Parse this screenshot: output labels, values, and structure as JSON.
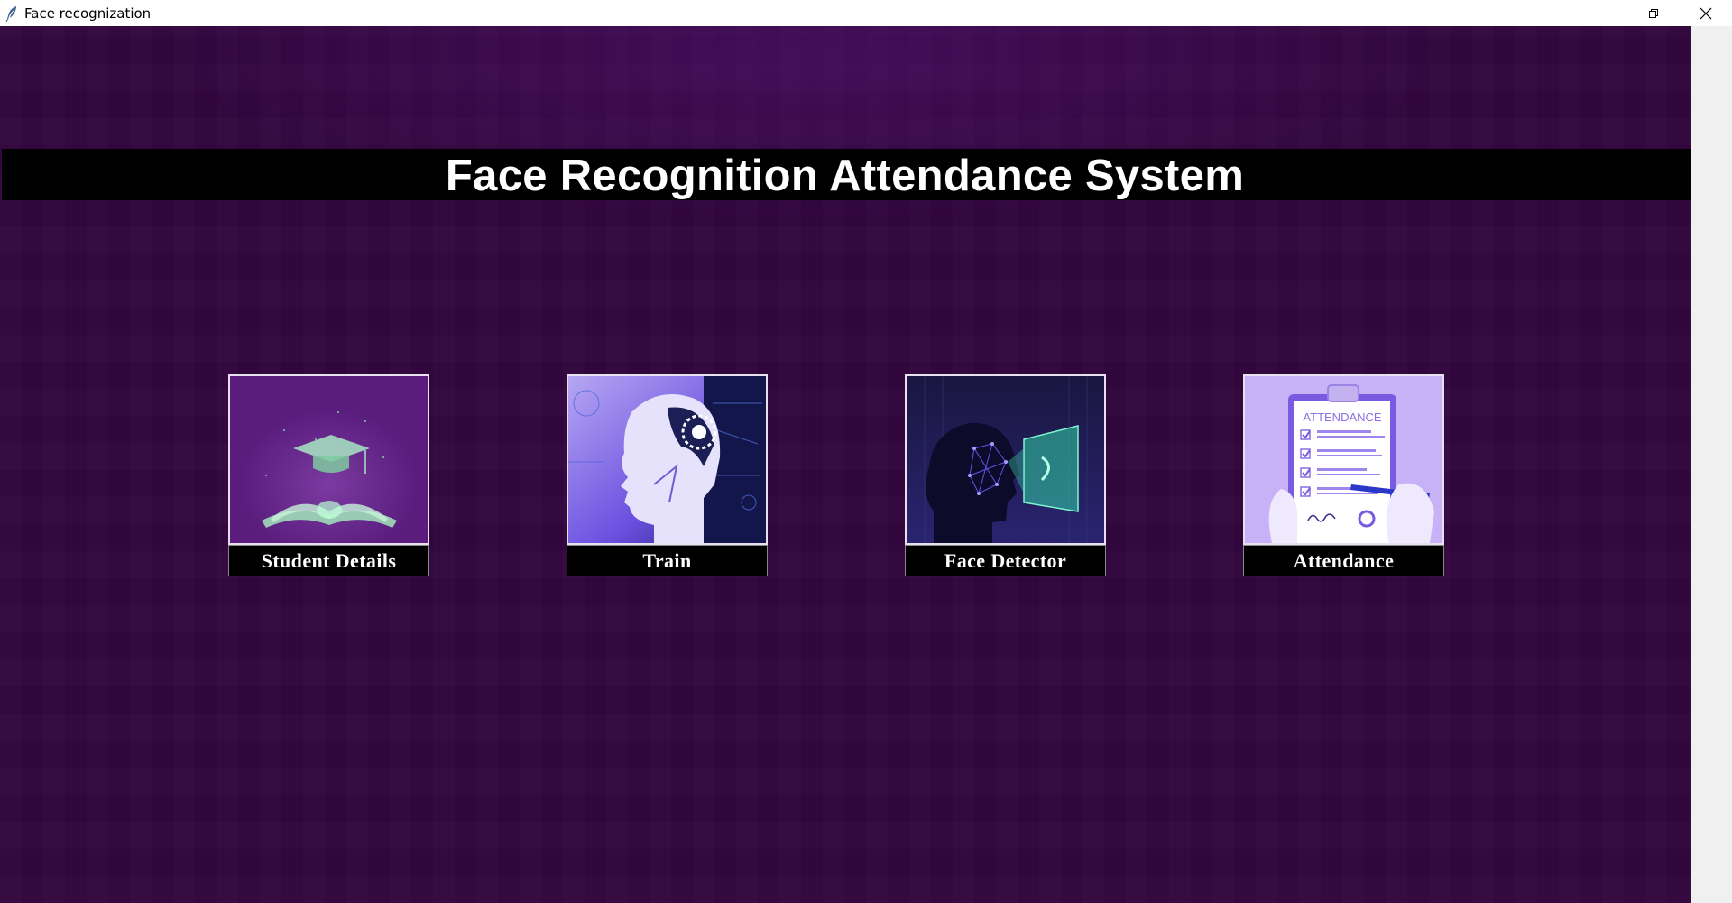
{
  "window": {
    "title": "Face recognization",
    "controls": {
      "minimize": "minimize-icon",
      "restore": "restore-icon",
      "close": "close-icon"
    }
  },
  "banner": {
    "title": "Face Recognition Attendance System"
  },
  "tiles": [
    {
      "label": "Student Details",
      "icon": "graduation-book-icon"
    },
    {
      "label": "Train",
      "icon": "ai-head-icon"
    },
    {
      "label": "Face Detector",
      "icon": "face-scan-icon"
    },
    {
      "label": "Attendance",
      "icon": "attendance-clipboard-icon"
    }
  ],
  "image_text": {
    "attendance_header": "ATTENDANCE"
  },
  "colors": {
    "background": "#33063f",
    "banner": "#000000",
    "banner_text": "#ffffff",
    "tile_label_bg": "#000000"
  }
}
